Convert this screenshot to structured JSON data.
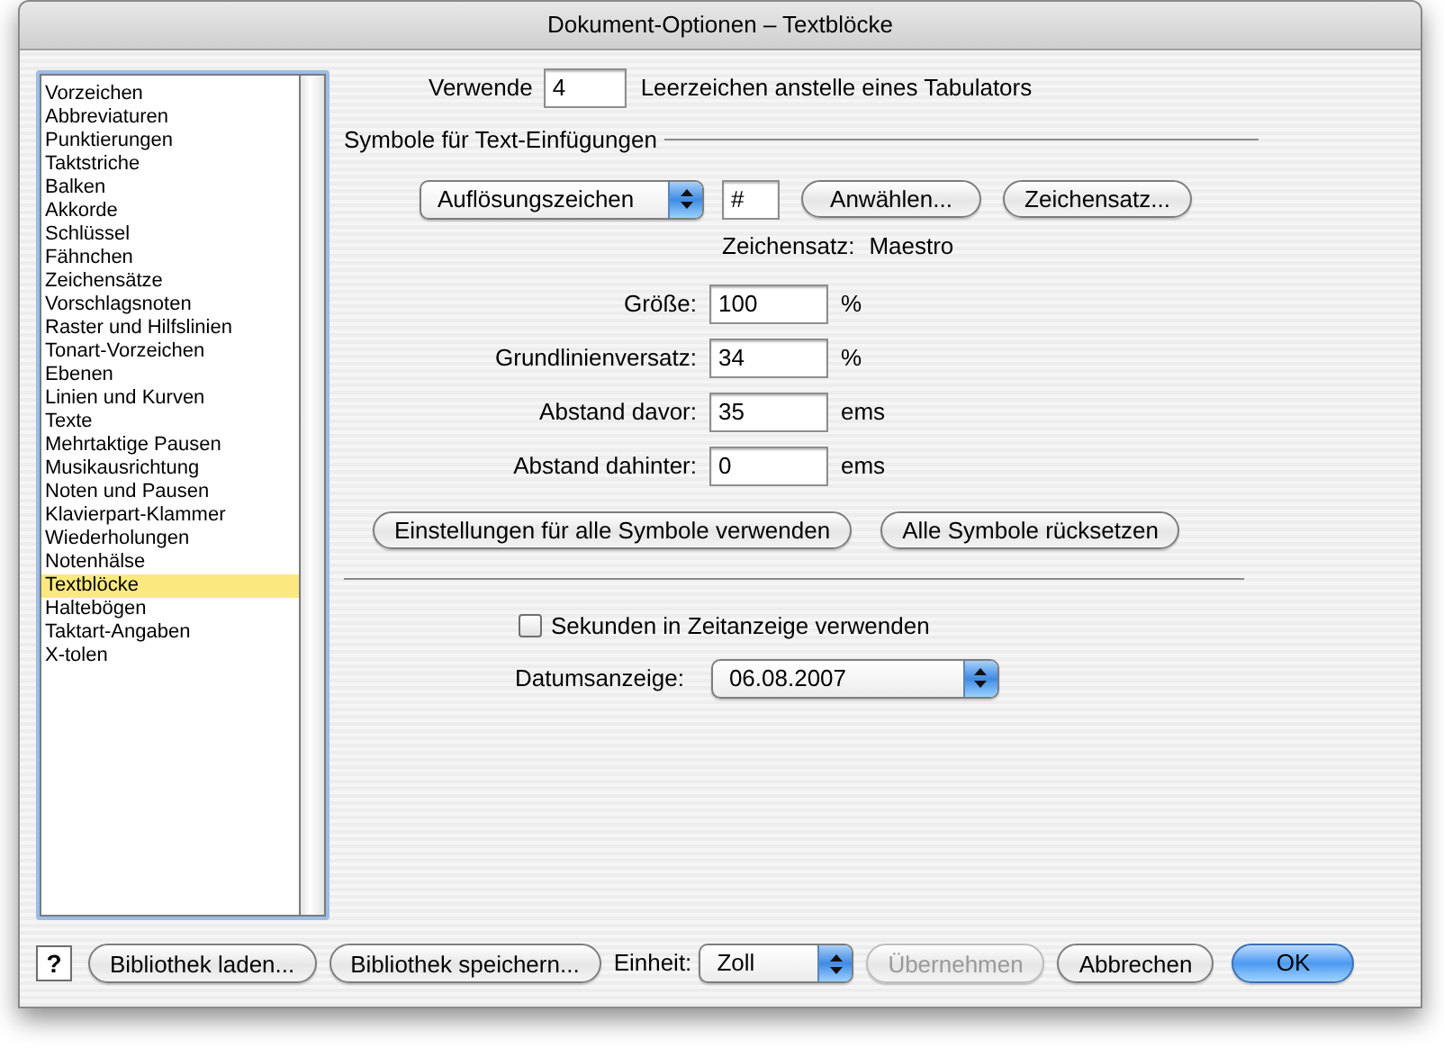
{
  "window": {
    "title": "Dokument-Optionen – Textblöcke"
  },
  "sidebar": {
    "items": [
      {
        "label": "Vorzeichen",
        "selected": false
      },
      {
        "label": "Abbreviaturen",
        "selected": false
      },
      {
        "label": "Punktierungen",
        "selected": false
      },
      {
        "label": "Taktstriche",
        "selected": false
      },
      {
        "label": "Balken",
        "selected": false
      },
      {
        "label": "Akkorde",
        "selected": false
      },
      {
        "label": "Schlüssel",
        "selected": false
      },
      {
        "label": "Fähnchen",
        "selected": false
      },
      {
        "label": "Zeichensätze",
        "selected": false
      },
      {
        "label": "Vorschlagsnoten",
        "selected": false
      },
      {
        "label": "Raster und Hilfslinien",
        "selected": false
      },
      {
        "label": "Tonart-Vorzeichen",
        "selected": false
      },
      {
        "label": "Ebenen",
        "selected": false
      },
      {
        "label": "Linien und Kurven",
        "selected": false
      },
      {
        "label": "Texte",
        "selected": false
      },
      {
        "label": "Mehrtaktige Pausen",
        "selected": false
      },
      {
        "label": "Musikausrichtung",
        "selected": false
      },
      {
        "label": "Noten und Pausen",
        "selected": false
      },
      {
        "label": "Klavierpart-Klammer",
        "selected": false
      },
      {
        "label": "Wiederholungen",
        "selected": false
      },
      {
        "label": "Notenhälse",
        "selected": false
      },
      {
        "label": "Textblöcke",
        "selected": true
      },
      {
        "label": "Haltebögen",
        "selected": false
      },
      {
        "label": "Taktart-Angaben",
        "selected": false
      },
      {
        "label": "X-tolen",
        "selected": false
      }
    ]
  },
  "tab_spaces": {
    "label_before": "Verwende",
    "value": "4",
    "label_after": "Leerzeichen anstelle eines Tabulators"
  },
  "symbols": {
    "heading": "Symbole für Text-Einfügungen",
    "symbol_popup": "Auflösungszeichen",
    "character": "#",
    "buttons": [
      "Anwählen...",
      "Zeichensatz..."
    ],
    "font_label": "Zeichensatz:",
    "font_name": "Maestro",
    "fields": [
      {
        "label": "Größe:",
        "value": "100",
        "unit": "%"
      },
      {
        "label": "Grundlinienversatz:",
        "value": "34",
        "unit": "%"
      },
      {
        "label": "Abstand davor:",
        "value": "35",
        "unit": "ems"
      },
      {
        "label": "Abstand dahinter:",
        "value": "0",
        "unit": "ems"
      }
    ],
    "actions": [
      "Einstellungen für alle Symbole verwenden",
      "Alle Symbole rücksetzen"
    ]
  },
  "seconds_checkbox": {
    "label": "Sekunden in Zeitanzeige verwenden",
    "checked": false
  },
  "date_display": {
    "label": "Datumsanzeige:",
    "value": "06.08.2007"
  },
  "footer": [
    {
      "kind": "help",
      "label": "?"
    },
    {
      "kind": "button",
      "label": "Bibliothek laden...",
      "disabled": false,
      "default": false
    },
    {
      "kind": "button",
      "label": "Bibliothek speichern...",
      "disabled": false,
      "default": false
    },
    {
      "kind": "label",
      "label": "Einheit:"
    },
    {
      "kind": "popup",
      "label": "Zoll"
    },
    {
      "kind": "button",
      "label": "Übernehmen",
      "disabled": true,
      "default": false
    },
    {
      "kind": "button",
      "label": "Abbrechen",
      "disabled": false,
      "default": false
    },
    {
      "kind": "button",
      "label": "OK",
      "disabled": false,
      "default": true
    }
  ]
}
